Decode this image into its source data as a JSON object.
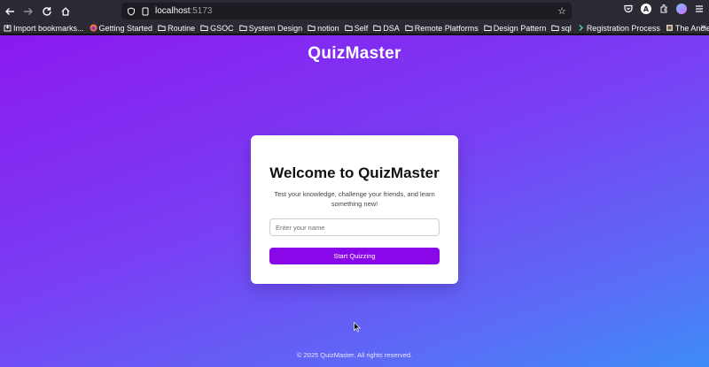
{
  "browser": {
    "url_host": "localhost",
    "url_port": ":5173",
    "bookmarks": [
      {
        "label": "Import bookmarks...",
        "icon": "import-icon"
      },
      {
        "label": "Getting Started",
        "icon": "firefox-icon"
      },
      {
        "label": "Routine",
        "icon": "folder-icon"
      },
      {
        "label": "GSOC",
        "icon": "folder-icon"
      },
      {
        "label": "System Design",
        "icon": "folder-icon"
      },
      {
        "label": "notion",
        "icon": "folder-icon"
      },
      {
        "label": "Self",
        "icon": "folder-icon"
      },
      {
        "label": "DSA",
        "icon": "folder-icon"
      },
      {
        "label": "Remote Platforms",
        "icon": "folder-icon"
      },
      {
        "label": "Design Pattern",
        "icon": "folder-icon"
      },
      {
        "label": "sql",
        "icon": "folder-icon"
      },
      {
        "label": "Registration Process",
        "icon": "link-icon"
      },
      {
        "label": "The Ancient Library's ...",
        "icon": "page-icon"
      }
    ],
    "avatar_letter": "A"
  },
  "app": {
    "brand": "QuizMaster",
    "card": {
      "title": "Welcome to QuizMaster",
      "subtitle": "Test your knowledge, challenge your friends, and learn something new!",
      "name_placeholder": "Enter your name",
      "start_label": "Start Quizzing"
    },
    "footer": "© 2025 QuizMaster. All rights reserved."
  },
  "colors": {
    "gradient_start": "#8b19ef",
    "gradient_end": "#3d8cf7",
    "button": "#8a07ea"
  }
}
